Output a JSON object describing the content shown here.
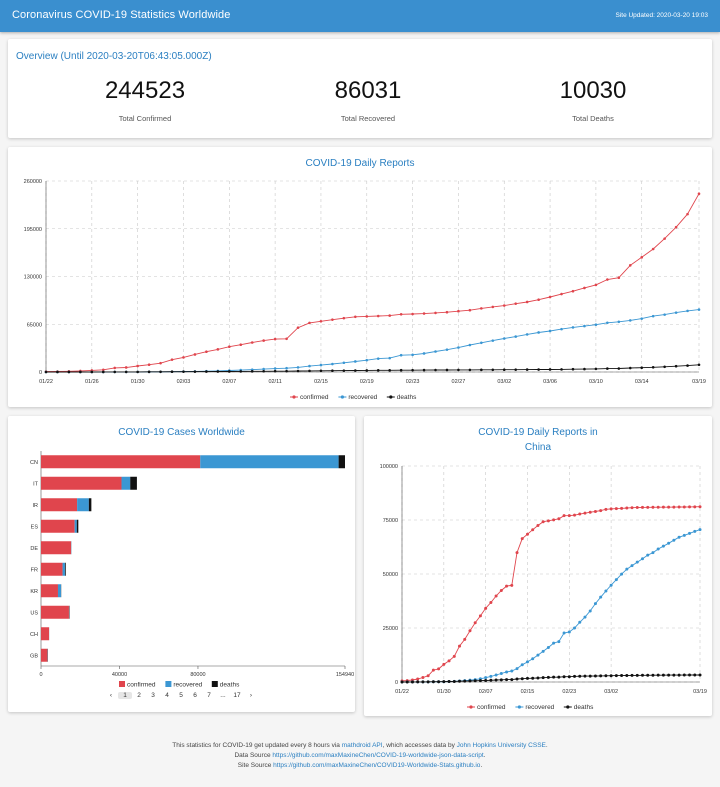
{
  "header": {
    "title": "Coronavirus COVID-19 Statistics Worldwide",
    "updated": "Site Updated: 2020-03-20 19:03"
  },
  "overview": {
    "title": "Overview (Until 2020-03-20T06:43:05.000Z)",
    "stats": [
      {
        "value": "244523",
        "label": "Total Confirmed"
      },
      {
        "value": "86031",
        "label": "Total Recovered"
      },
      {
        "value": "10030",
        "label": "Total Deaths"
      }
    ]
  },
  "colors": {
    "confirmed": "#e0454d",
    "recovered": "#3b97d3",
    "deaths": "#111111",
    "accent": "#3a8fcf"
  },
  "chart_data": [
    {
      "type": "line",
      "title": "COVID-19 Daily Reports",
      "ylim": [
        0,
        260000
      ],
      "yticks": [
        0,
        65000,
        130000,
        195000,
        260000
      ],
      "xtick_labels": [
        "01/22",
        "01/26",
        "01/30",
        "02/03",
        "02/07",
        "02/11",
        "02/15",
        "02/19",
        "02/23",
        "02/27",
        "03/02",
        "03/06",
        "03/10",
        "03/14",
        "03/19"
      ],
      "grid": true,
      "legend": "bottom",
      "series": [
        {
          "name": "confirmed",
          "values": [
            555,
            653,
            941,
            1434,
            2118,
            2927,
            5578,
            6166,
            8234,
            9927,
            12038,
            16787,
            19881,
            23892,
            27635,
            30817,
            34391,
            37120,
            40150,
            42762,
            44802,
            45221,
            60368,
            66885,
            69030,
            71224,
            73258,
            75136,
            75639,
            76197,
            76819,
            78572,
            78958,
            79561,
            80406,
            81388,
            82746,
            84112,
            86604,
            88585,
            90443,
            93016,
            95314,
            98425,
            102050,
            106099,
            109991,
            114422,
            118582,
            125865,
            128343,
            145193,
            156097,
            167449,
            181546,
            197168,
            214915,
            242713
          ]
        },
        {
          "name": "recovered",
          "values": [
            28,
            30,
            36,
            39,
            52,
            61,
            107,
            126,
            143,
            222,
            284,
            472,
            623,
            852,
            1124,
            1487,
            2011,
            2616,
            3244,
            3946,
            4683,
            5150,
            6295,
            8058,
            9395,
            10865,
            12583,
            14352,
            16121,
            18177,
            18890,
            22886,
            23394,
            25227,
            27905,
            30384,
            33277,
            36711,
            39782,
            42716,
            45602,
            48228,
            51170,
            53796,
            55865,
            58359,
            60694,
            62494,
            64404,
            67003,
            68324,
            70251,
            72624,
            76034,
            78088,
            80840,
            83207,
            84962
          ]
        },
        {
          "name": "deaths",
          "values": [
            17,
            18,
            26,
            42,
            56,
            82,
            131,
            133,
            171,
            213,
            259,
            362,
            426,
            492,
            564,
            634,
            719,
            806,
            906,
            1013,
            1113,
            1118,
            1371,
            1523,
            1666,
            1770,
            1868,
            2007,
            2122,
            2247,
            2251,
            2458,
            2469,
            2629,
            2708,
            2770,
            2814,
            2872,
            2941,
            2996,
            3085,
            3160,
            3254,
            3348,
            3460,
            3558,
            3802,
            3988,
            4262,
            4615,
            4720,
            5404,
            5819,
            6440,
            7126,
            7905,
            8733,
            9867
          ]
        }
      ]
    },
    {
      "type": "bar",
      "title": "COVID-19 Cases Worldwide",
      "categories": [
        "CN",
        "IT",
        "IR",
        "ES",
        "DE",
        "FR",
        "KR",
        "US",
        "CH",
        "GB"
      ],
      "xlim": [
        0,
        154940
      ],
      "xtick_labels": [
        "0",
        "40000",
        "80000",
        "154940"
      ],
      "legend": "bottom",
      "series": [
        {
          "name": "confirmed",
          "values": [
            81156,
            41035,
            18407,
            17147,
            15320,
            10995,
            8652,
            14250,
            4075,
            3269
          ]
        },
        {
          "name": "recovered",
          "values": [
            70535,
            4440,
            5979,
            1107,
            113,
            1295,
            1540,
            121,
            15,
            65
          ]
        },
        {
          "name": "deaths",
          "values": [
            3249,
            3405,
            1284,
            767,
            44,
            372,
            94,
            205,
            43,
            144
          ]
        }
      ]
    },
    {
      "type": "line",
      "title": "COVID-19 Daily Reports in China",
      "ylim": [
        0,
        100000
      ],
      "yticks": [
        0,
        25000,
        50000,
        75000,
        100000
      ],
      "xtick_labels": [
        "01/22",
        "01/30",
        "02/07",
        "02/15",
        "02/23",
        "03/02",
        "03/19"
      ],
      "grid": true,
      "legend": "bottom",
      "series": [
        {
          "name": "confirmed",
          "values": [
            548,
            643,
            920,
            1406,
            2075,
            2877,
            5509,
            6087,
            8141,
            9802,
            11891,
            16630,
            19716,
            23707,
            27440,
            30587,
            34110,
            36814,
            39829,
            42354,
            44386,
            44759,
            59895,
            66358,
            68413,
            70513,
            72434,
            74211,
            74619,
            75077,
            75550,
            77001,
            77022,
            77241,
            77754,
            78166,
            78600,
            78928,
            79356,
            79932,
            80136,
            80261,
            80386,
            80537,
            80690,
            80770,
            80823,
            80860,
            80887,
            80921,
            80932,
            80945,
            80977,
            81003,
            81033,
            81058,
            81102,
            81156
          ]
        },
        {
          "name": "recovered",
          "values": [
            28,
            30,
            36,
            39,
            49,
            58,
            101,
            120,
            135,
            214,
            275,
            463,
            614,
            843,
            1115,
            1477,
            1999,
            2596,
            3219,
            3918,
            4636,
            5082,
            6217,
            7977,
            9298,
            10755,
            12462,
            14206,
            15962,
            18014,
            18704,
            22699,
            23170,
            24990,
            27650,
            30053,
            32898,
            36291,
            39279,
            42118,
            44810,
            47404,
            49955,
            52240,
            53888,
            55478,
            57043,
            58735,
            59882,
            61567,
            62887,
            64216,
            65649,
            67022,
            67863,
            68799,
            69725,
            70535
          ]
        },
        {
          "name": "deaths",
          "values": [
            17,
            18,
            26,
            42,
            56,
            82,
            131,
            133,
            171,
            213,
            259,
            361,
            425,
            490,
            562,
            632,
            717,
            804,
            904,
            1011,
            1111,
            1116,
            1368,
            1520,
            1662,
            1765,
            1863,
            2002,
            2114,
            2236,
            2236,
            2441,
            2443,
            2593,
            2663,
            2715,
            2744,
            2788,
            2835,
            2870,
            2912,
            2945,
            2981,
            3013,
            3042,
            3070,
            3097,
            3119,
            3136,
            3158,
            3169,
            3176,
            3189,
            3199,
            3213,
            3226,
            3237,
            3249
          ]
        }
      ]
    }
  ],
  "pagination": {
    "prev": "‹",
    "pages": [
      "1",
      "2",
      "3",
      "4",
      "5",
      "6",
      "7"
    ],
    "ellipsis": "...",
    "last": "17",
    "next": "›"
  },
  "footer": {
    "line1_prefix": "This statistics for COVID-19 get updated every 8 hours via",
    "line1_link1": "mathdroid API",
    "line1_middle": ", which accesses data by",
    "line1_link2": "John Hopkins University CSSE",
    "line1_suffix": ".",
    "line2_prefix": "Data Source",
    "line2_link": "https://github.com/maxMaxineChen/COVID-19-worldwide-json-data-script",
    "line2_suffix": ".",
    "line3_prefix": "Site Source",
    "line3_link": "https://github.com/maxMaxineChen/COVID19-Worldwide-Stats.github.io",
    "line3_suffix": "."
  }
}
